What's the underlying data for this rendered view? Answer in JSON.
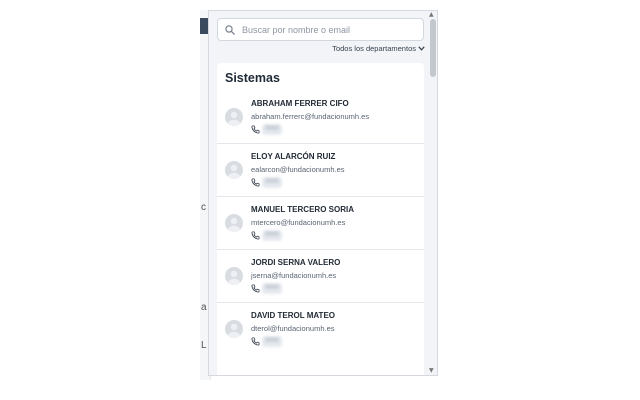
{
  "search": {
    "placeholder": "Buscar por nombre o email"
  },
  "filter": {
    "label": "Todos los departamentos"
  },
  "section": {
    "title": "Sistemas"
  },
  "contacts": [
    {
      "name": "ABRAHAM FERRER CIFO",
      "email": "abraham.ferrerc@fundacionumh.es",
      "ext": "0000"
    },
    {
      "name": "ELOY ALARCÓN RUIZ",
      "email": "ealarcon@fundacionumh.es",
      "ext": "0000"
    },
    {
      "name": "MANUEL TERCERO SORIA",
      "email": "mtercero@fundacionumh.es",
      "ext": "0000"
    },
    {
      "name": "JORDI SERNA VALERO",
      "email": "jserna@fundacionumh.es",
      "ext": "0000"
    },
    {
      "name": "DAVID TEROL MATEO",
      "email": "dterol@fundacionumh.es",
      "ext": "0000"
    }
  ],
  "background_glyphs": [
    "c",
    "a",
    "L"
  ],
  "colors": {
    "accent": "#1f2a37",
    "panel_bg": "#f2f4f7",
    "avatar": "#d9dde2"
  }
}
